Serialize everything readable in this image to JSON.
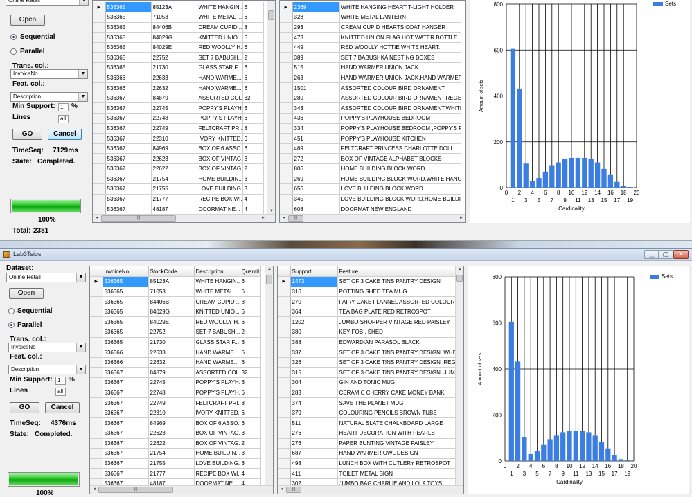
{
  "app": {
    "title": "Lab3Tsios"
  },
  "controls": {
    "dataset_label": "Dataset:",
    "dataset_value": "Online Retail",
    "open_button": "Open",
    "sequential_label": "Sequential",
    "parallel_label": "Parallel",
    "trans_col_label": "Trans. col.:",
    "trans_col_value": "InvoiceNo",
    "feat_col_label": "Feat. col.:",
    "feat_col_value": "Description",
    "min_support_label": "Min Support:",
    "min_support_value": "1",
    "percent_sign": "%",
    "lines_label": "Lines",
    "lines_value": "all",
    "go_button": "GO",
    "cancel_button": "Cancel",
    "state_label": "State:",
    "total_label": "Total:"
  },
  "top_window": {
    "mode": "sequential",
    "time_label": "TimeSeq:",
    "time_value": "7129ms",
    "state_value": "Completed.",
    "progress_value": 1.0,
    "progress_text": "100%",
    "total_value": "2381",
    "supports": [
      "2369",
      "328",
      "293",
      "473",
      "449",
      "389",
      "515",
      "263",
      "1501",
      "280",
      "343",
      "436",
      "334",
      "451",
      "469",
      "272",
      "806",
      "269",
      "656",
      "345",
      "608"
    ],
    "features": [
      "WHITE HANGING HEART T-LIGHT HOLDER",
      "WHITE METAL LANTERN",
      "CREAM CUPID HEARTS COAT HANGER",
      "KNITTED UNION FLAG HOT WATER BOTTLE",
      "RED WOOLLY HOTTIE WHITE HEART.",
      "SET 7 BABUSHKA NESTING BOXES",
      "HAND WARMER UNION JACK",
      "HAND WARMER UNION JACK,HAND WARMER C",
      "ASSORTED COLOUR BIRD ORNAMENT",
      "ASSORTED COLOUR BIRD ORNAMENT,REGENC",
      "ASSORTED COLOUR BIRD ORNAMENT,WHITE I",
      "POPPY'S PLAYHOUSE BEDROOM",
      "POPPY'S PLAYHOUSE BEDROOM ,POPPY'S PLA",
      "POPPY'S PLAYHOUSE KITCHEN",
      "FELTCRAFT PRINCESS CHARLOTTE DOLL",
      "BOX OF VINTAGE ALPHABET BLOCKS",
      "HOME BUILDING BLOCK WORD",
      "HOME BUILDING BLOCK WORD,WHITE HANGIN",
      "LOVE BUILDING BLOCK WORD",
      "LOVE BUILDING BLOCK WORD,HOME BUILDING",
      "DOORMAT NEW ENGLAND"
    ]
  },
  "bottom_window": {
    "mode": "parallel",
    "time_label": "TimeSeq:",
    "time_value": "4376ms",
    "state_value": "Completed.",
    "progress_value": 1.0,
    "progress_text": "100%",
    "supports": [
      "1473",
      "316",
      "270",
      "364",
      "1202",
      "380",
      "388",
      "337",
      "326",
      "315",
      "304",
      "283",
      "374",
      "379",
      "511",
      "276",
      "276",
      "687",
      "498",
      "411",
      "302"
    ],
    "features": [
      "SET OF 3 CAKE TINS PANTRY DESIGN",
      "POTTING SHED TEA MUG",
      "FAIRY CAKE FLANNEL ASSORTED COLOUR",
      "TEA BAG PLATE RED RETROSPOT",
      "JUMBO SHOPPER VINTAGE RED PAISLEY",
      "KEY FOB , SHED",
      "EDWARDIAN PARASOL BLACK",
      "SET OF 3 CAKE TINS PANTRY DESIGN ,WHITE I",
      "SET OF 3 CAKE TINS PANTRY DESIGN ,REGENC",
      "SET OF 3 CAKE TINS PANTRY DESIGN ,JUMBO I",
      "GIN AND TONIC MUG",
      "CERAMIC CHERRY CAKE MONEY BANK",
      "SAVE THE PLANET MUG",
      "COLOURING PENCILS BROWN TUBE",
      "NATURAL SLATE CHALKBOARD LARGE",
      "HEART DECORATION WITH PEARLS",
      "PAPER BUNTING VINTAGE PAISLEY",
      "HAND WARMER OWL DESIGN",
      "LUNCH BOX WITH CUTLERY RETROSPOT",
      "TOILET METAL SIGN",
      "JUMBO BAG CHARLIE AND LOLA TOYS"
    ]
  },
  "transactions": {
    "headers": [
      "InvoiceNo",
      "StockCode",
      "Description",
      "Quantit"
    ],
    "rows": [
      [
        "536365",
        "85123A",
        "WHITE HANGIN...",
        "6"
      ],
      [
        "536365",
        "71053",
        "WHITE METAL ...",
        "6"
      ],
      [
        "536365",
        "84406B",
        "CREAM CUPID ...",
        "8"
      ],
      [
        "536365",
        "84029G",
        "KNITTED UNIO...",
        "6"
      ],
      [
        "536365",
        "84029E",
        "RED WOOLLY H...",
        "6"
      ],
      [
        "536365",
        "22752",
        "SET 7 BABUSH...",
        "2"
      ],
      [
        "536365",
        "21730",
        "GLASS STAR F...",
        "6"
      ],
      [
        "536366",
        "22633",
        "HAND WARME...",
        "6"
      ],
      [
        "536366",
        "22632",
        "HAND WARME...",
        "6"
      ],
      [
        "536367",
        "84879",
        "ASSORTED COL...",
        "32"
      ],
      [
        "536367",
        "22745",
        "POPPY'S PLAYH...",
        "6"
      ],
      [
        "536367",
        "22748",
        "POPPY'S PLAYH...",
        "6"
      ],
      [
        "536367",
        "22749",
        "FELTCRAFT PRI...",
        "8"
      ],
      [
        "536367",
        "22310",
        "IVORY KNITTED...",
        "6"
      ],
      [
        "536367",
        "84969",
        "BOX OF 6 ASSO...",
        "6"
      ],
      [
        "536367",
        "22623",
        "BOX OF VINTAG...",
        "3"
      ],
      [
        "536367",
        "22622",
        "BOX OF VINTAG...",
        "2"
      ],
      [
        "536367",
        "21754",
        "HOME BUILDIN...",
        "3"
      ],
      [
        "536367",
        "21755",
        "LOVE BUILDING...",
        "3"
      ],
      [
        "536367",
        "21777",
        "RECIPE BOX WI...",
        "4"
      ],
      [
        "536367",
        "48187",
        "DOORMAT NE...",
        "4"
      ]
    ]
  },
  "feature_headers": [
    "Support",
    "Feature"
  ],
  "chart_data": [
    {
      "type": "bar",
      "xlabel": "Cardinality",
      "ylabel": "Amount of sets",
      "legend": [
        "Sets"
      ],
      "legend_position": "top-right",
      "grid": true,
      "xlim": [
        0,
        20
      ],
      "ylim": [
        0,
        800
      ],
      "x_ticks_top": [
        "0",
        "2",
        "4",
        "6",
        "8",
        "10",
        "12",
        "14",
        "16",
        "18",
        "20"
      ],
      "x_ticks_bottom": [
        "1",
        "3",
        "5",
        "7",
        "9",
        "11",
        "13",
        "15",
        "17",
        "19"
      ],
      "y_ticks": [
        "0",
        "200",
        "400",
        "600",
        "800"
      ],
      "x": [
        1,
        2,
        3,
        4,
        5,
        6,
        7,
        8,
        9,
        10,
        11,
        12,
        13,
        14,
        15,
        16,
        17,
        18,
        19
      ],
      "values": [
        605,
        432,
        105,
        30,
        42,
        70,
        95,
        110,
        125,
        130,
        130,
        130,
        125,
        110,
        82,
        55,
        25,
        8,
        3
      ]
    },
    {
      "type": "bar",
      "xlabel": "Cardinality",
      "ylabel": "Amount of sets",
      "legend": [
        "Sets"
      ],
      "legend_position": "top-right",
      "grid": true,
      "xlim": [
        0,
        20
      ],
      "ylim": [
        0,
        800
      ],
      "x_ticks_top": [
        "0",
        "2",
        "4",
        "6",
        "8",
        "10",
        "12",
        "14",
        "16",
        "18",
        "20"
      ],
      "x_ticks_bottom": [
        "1",
        "3",
        "5",
        "7",
        "9",
        "11",
        "13",
        "15",
        "17",
        "19"
      ],
      "y_ticks": [
        "0",
        "200",
        "400",
        "600",
        "800"
      ],
      "x": [
        1,
        2,
        3,
        4,
        5,
        6,
        7,
        8,
        9,
        10,
        11,
        12,
        13,
        14,
        15,
        16,
        17,
        18,
        19
      ],
      "values": [
        605,
        432,
        105,
        30,
        42,
        70,
        95,
        110,
        125,
        130,
        130,
        130,
        125,
        110,
        82,
        55,
        25,
        8,
        3
      ]
    }
  ]
}
